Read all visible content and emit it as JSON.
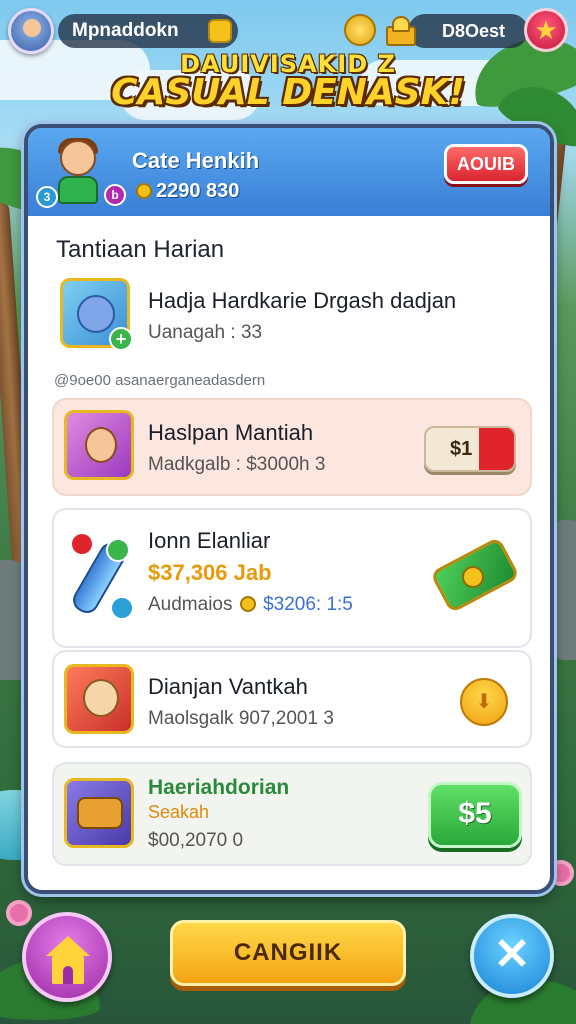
{
  "top_bar": {
    "player_name": "Mpnaddokn",
    "currency_value": "D8Oest"
  },
  "title": {
    "line1": "DAUIVISAKID Z",
    "line2": "CASUAL DENASK!"
  },
  "panel": {
    "header": {
      "name": "Cate Henkih",
      "gold": "2290 830",
      "button_label": "AOUIB"
    },
    "section_title": "Tantiaan Harian",
    "note": "@9oe00 asanaerganeadasdern",
    "items": [
      {
        "title": "Hadja Hardkarie Drgash dadjan",
        "subtitle": "Uanagah : 33"
      },
      {
        "title": "Haslpan Mantiah",
        "subtitle": "Madkgalb : $3000h 3",
        "action": "$1"
      },
      {
        "title": "Ionn Elanliar",
        "price": "$37,306 Jab",
        "subtitle": "Audmaios",
        "subtitle_value": "$3206: 1:5"
      },
      {
        "title": "Dianjan Vantkah",
        "subtitle": "Maolsgalk 907,2001 3"
      },
      {
        "title": "Haeriahdorian",
        "subtitle_top": "Seakah",
        "subtitle": "$00,2070 0",
        "action": "$5"
      }
    ]
  },
  "bottom": {
    "main_button": "CANGIIK"
  },
  "colors": {
    "accent_blue": "#3a7fd6",
    "accent_red": "#d8242e",
    "accent_gold": "#f4a412",
    "accent_green": "#36b44a"
  }
}
